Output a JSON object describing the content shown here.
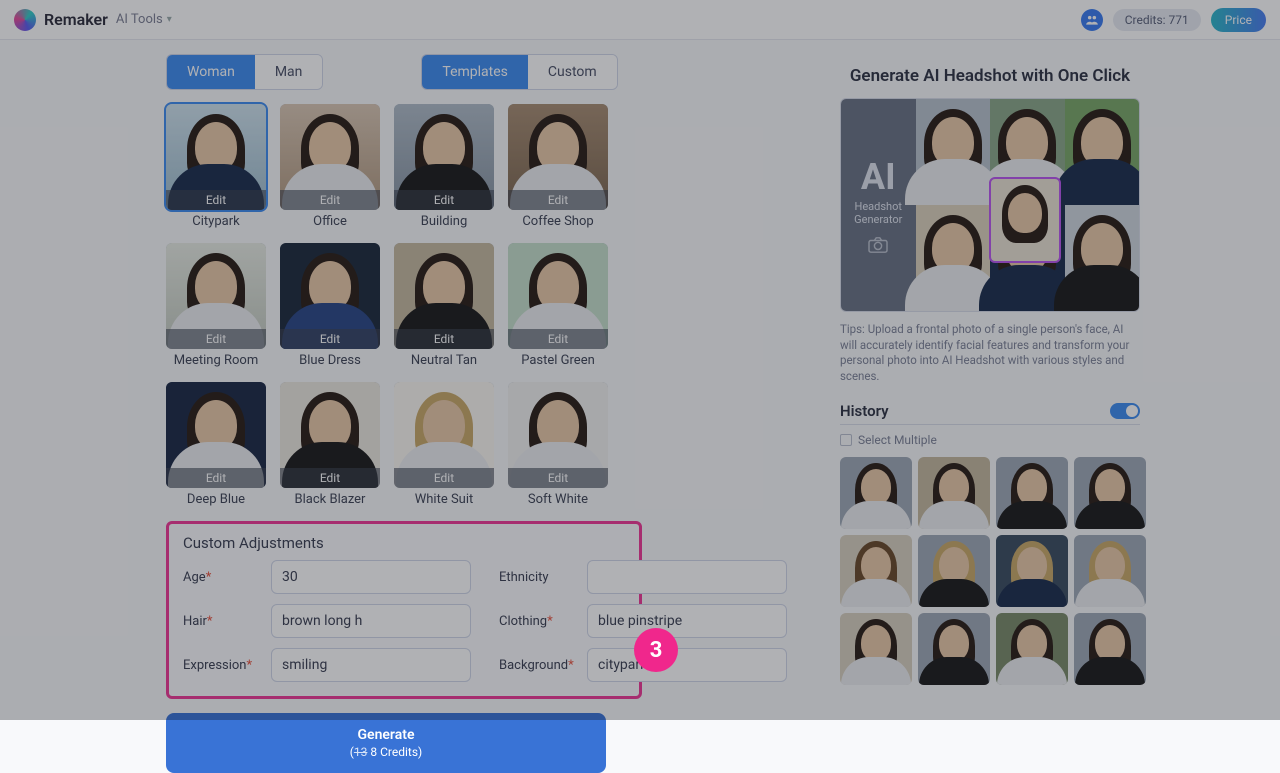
{
  "header": {
    "brand": "Remaker",
    "tools": "AI Tools",
    "credits": "Credits: 771",
    "price": "Price"
  },
  "tabs": {
    "gender": [
      "Woman",
      "Man"
    ],
    "mode": [
      "Templates",
      "Custom"
    ]
  },
  "templates": [
    {
      "label": "Citypark",
      "edit": "Edit"
    },
    {
      "label": "Office",
      "edit": "Edit"
    },
    {
      "label": "Building",
      "edit": "Edit"
    },
    {
      "label": "Coffee Shop",
      "edit": "Edit"
    },
    {
      "label": "Meeting Room",
      "edit": "Edit"
    },
    {
      "label": "Blue Dress",
      "edit": "Edit"
    },
    {
      "label": "Neutral Tan",
      "edit": "Edit"
    },
    {
      "label": "Pastel Green",
      "edit": "Edit"
    },
    {
      "label": "Deep Blue",
      "edit": "Edit"
    },
    {
      "label": "Black Blazer",
      "edit": "Edit"
    },
    {
      "label": "White Suit",
      "edit": "Edit"
    },
    {
      "label": "Soft White",
      "edit": "Edit"
    }
  ],
  "custom": {
    "title": "Custom Adjustments",
    "fields": {
      "age": {
        "label": "Age",
        "value": "30",
        "required": true
      },
      "ethnicity": {
        "label": "Ethnicity",
        "value": "",
        "required": false
      },
      "hair": {
        "label": "Hair",
        "value": "brown long h",
        "required": true
      },
      "clothing": {
        "label": "Clothing",
        "value": "blue pinstripe",
        "required": true
      },
      "expression": {
        "label": "Expression",
        "value": "smiling",
        "required": true
      },
      "background": {
        "label": "Background",
        "value": "citypark",
        "required": true
      }
    }
  },
  "generate": {
    "title": "Generate",
    "old": "13",
    "new": "8 Credits)"
  },
  "right": {
    "title": "Generate AI Headshot with One Click",
    "hero": {
      "ai": "AI",
      "sub1": "Headshot",
      "sub2": "Generator"
    },
    "tips": "Tips: Upload a frontal photo of a single person's face, AI will accurately identify facial features and transform your personal photo into AI Headshot with various styles and scenes.",
    "history": "History",
    "select_multiple": "Select Multiple"
  },
  "marker": "3"
}
